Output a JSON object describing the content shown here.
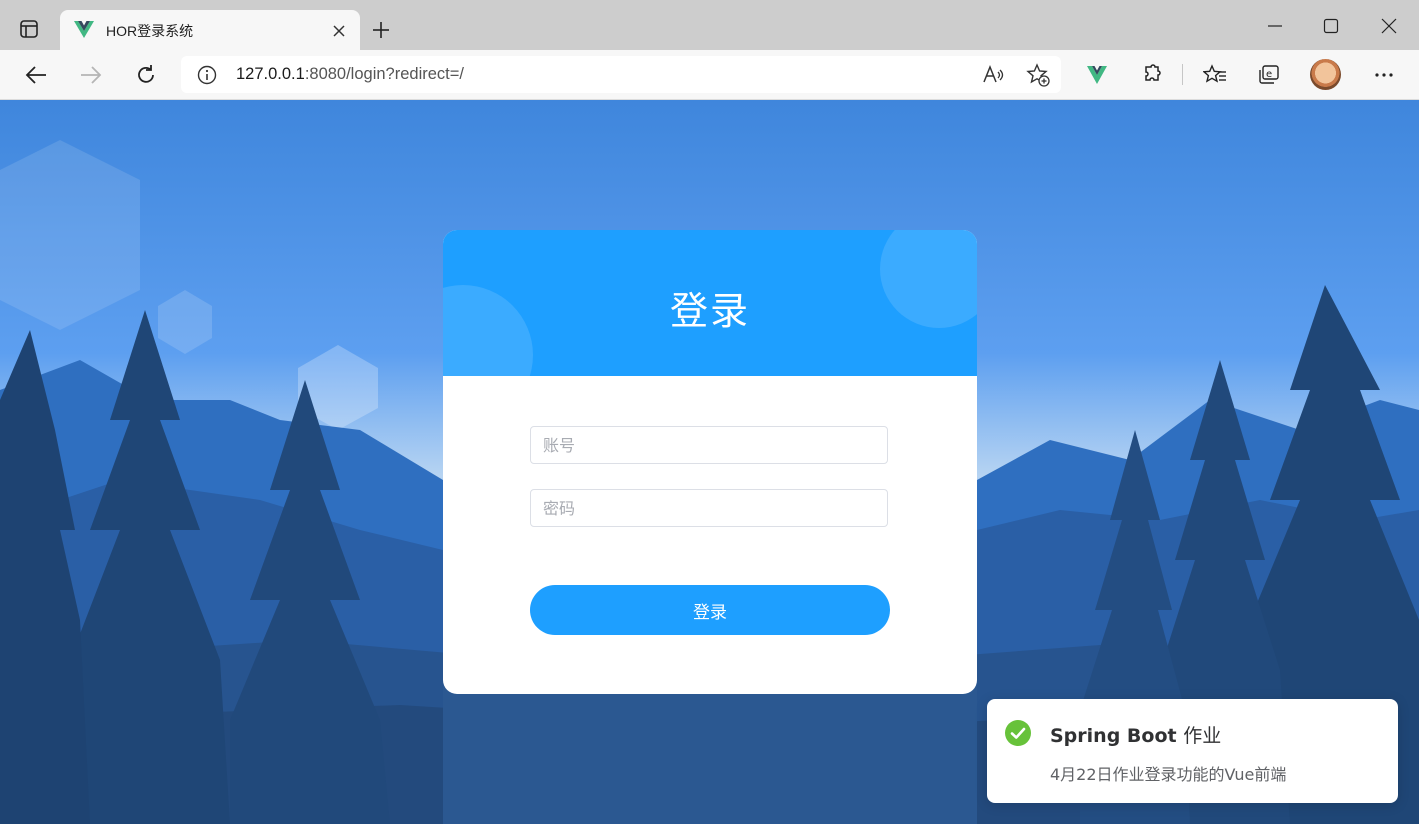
{
  "browser": {
    "tab_title": "HOR登录系统",
    "address_host": "127.0.0.1",
    "address_rest": ":8080/login?redirect=/",
    "icons": [
      "tab-actions-icon",
      "vue-favicon-icon",
      "close-icon",
      "plus-icon",
      "minimize-icon",
      "maximize-icon",
      "window-close-icon",
      "back-arrow-icon",
      "forward-arrow-icon",
      "refresh-icon",
      "info-icon",
      "read-aloud-icon",
      "add-favorite-icon",
      "vue-devtools-icon",
      "extensions-icon",
      "favorites-icon",
      "collections-icon",
      "profile-avatar",
      "more-icon"
    ]
  },
  "login": {
    "title": "登录",
    "username_placeholder": "账号",
    "password_placeholder": "密码",
    "submit_label": "登录",
    "accent_color": "#1e9fff"
  },
  "notification": {
    "title_en": "Spring Boot",
    "title_cn": "作业",
    "message": "4月22日作业登录功能的Vue前端",
    "status": "success",
    "status_color": "#67c23a"
  }
}
